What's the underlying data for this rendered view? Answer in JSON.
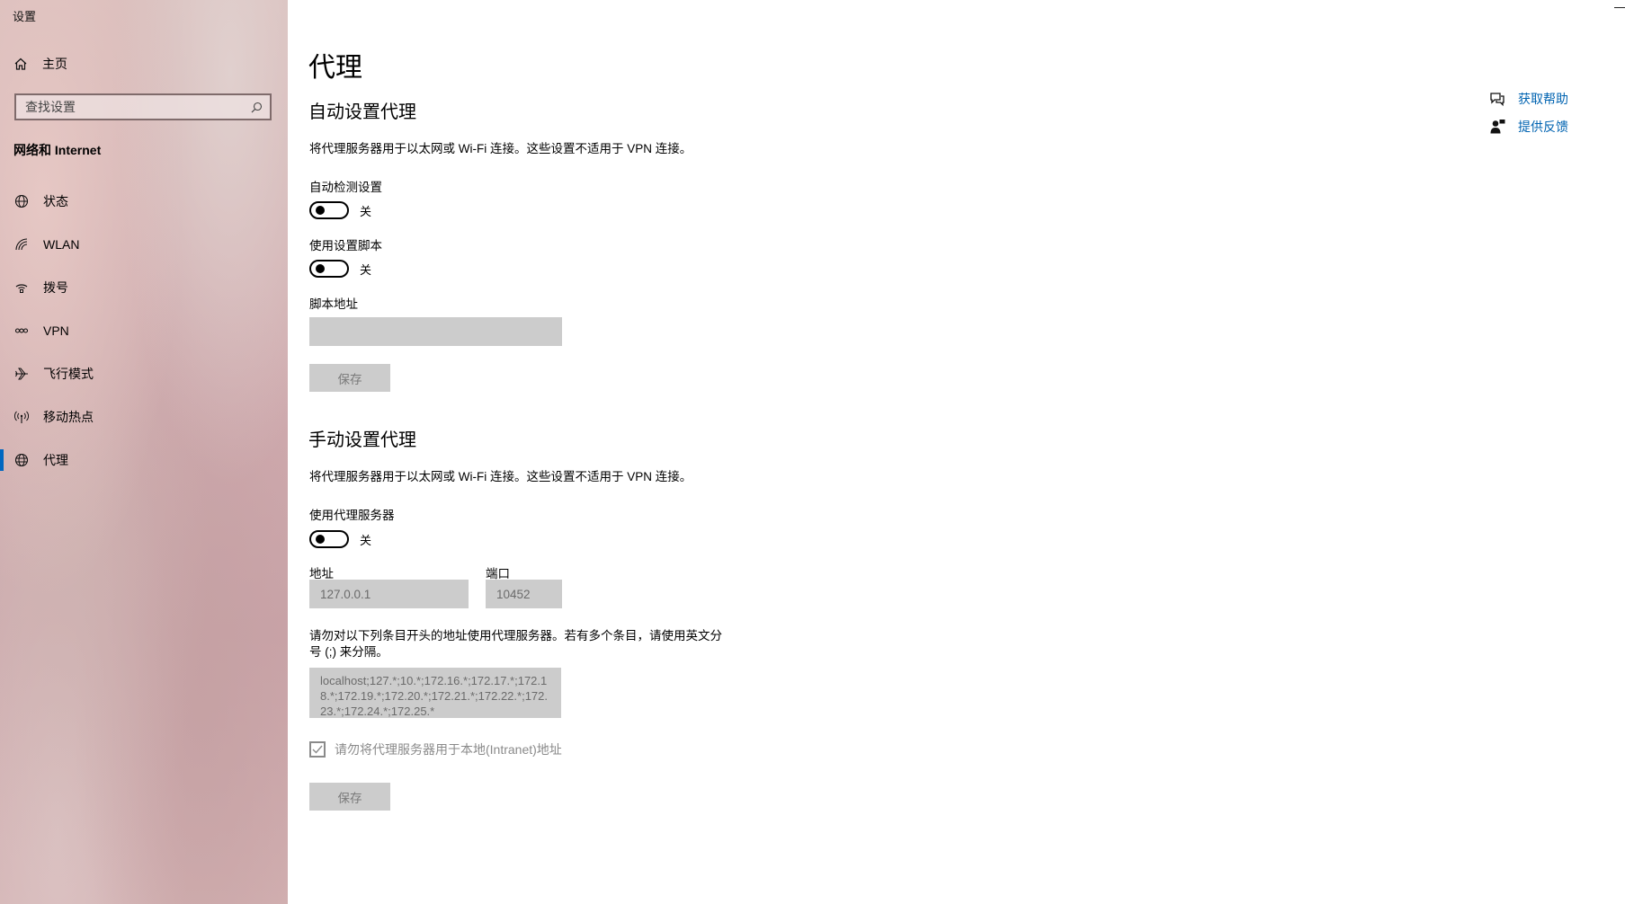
{
  "app": {
    "title": "设置"
  },
  "sidebar": {
    "home_label": "主页",
    "search_placeholder": "查找设置",
    "section_title": "网络和 Internet",
    "items": [
      {
        "label": "状态",
        "icon": "status-globe-icon"
      },
      {
        "label": "WLAN",
        "icon": "wifi-icon"
      },
      {
        "label": "拨号",
        "icon": "dialup-icon"
      },
      {
        "label": "VPN",
        "icon": "vpn-icon"
      },
      {
        "label": "飞行模式",
        "icon": "airplane-icon"
      },
      {
        "label": "移动热点",
        "icon": "hotspot-icon"
      },
      {
        "label": "代理",
        "icon": "globe-icon",
        "active": true
      }
    ],
    "accent_color": "#0067c0"
  },
  "main": {
    "title": "代理",
    "auto": {
      "heading": "自动设置代理",
      "description": "将代理服务器用于以太网或 Wi-Fi 连接。这些设置不适用于 VPN 连接。",
      "detect_label": "自动检测设置",
      "detect_state": "关",
      "script_label": "使用设置脚本",
      "script_state": "关",
      "script_address_label": "脚本地址",
      "script_address_value": "",
      "save_label": "保存"
    },
    "manual": {
      "heading": "手动设置代理",
      "description": "将代理服务器用于以太网或 Wi-Fi 连接。这些设置不适用于 VPN 连接。",
      "use_proxy_label": "使用代理服务器",
      "use_proxy_state": "关",
      "address_label": "地址",
      "address_value": "127.0.0.1",
      "port_label": "端口",
      "port_value": "10452",
      "exceptions_description": "请勿对以下列条目开头的地址使用代理服务器。若有多个条目，请使用英文分号 (;) 来分隔。",
      "exceptions_value": "localhost;127.*;10.*;172.16.*;172.17.*;172.18.*;172.19.*;172.20.*;172.21.*;172.22.*;172.23.*;172.24.*;172.25.*",
      "local_bypass_label": "请勿将代理服务器用于本地(Intranet)地址",
      "save_label": "保存"
    }
  },
  "related": {
    "help_label": "获取帮助",
    "feedback_label": "提供反馈",
    "link_color": "#0063b1"
  }
}
